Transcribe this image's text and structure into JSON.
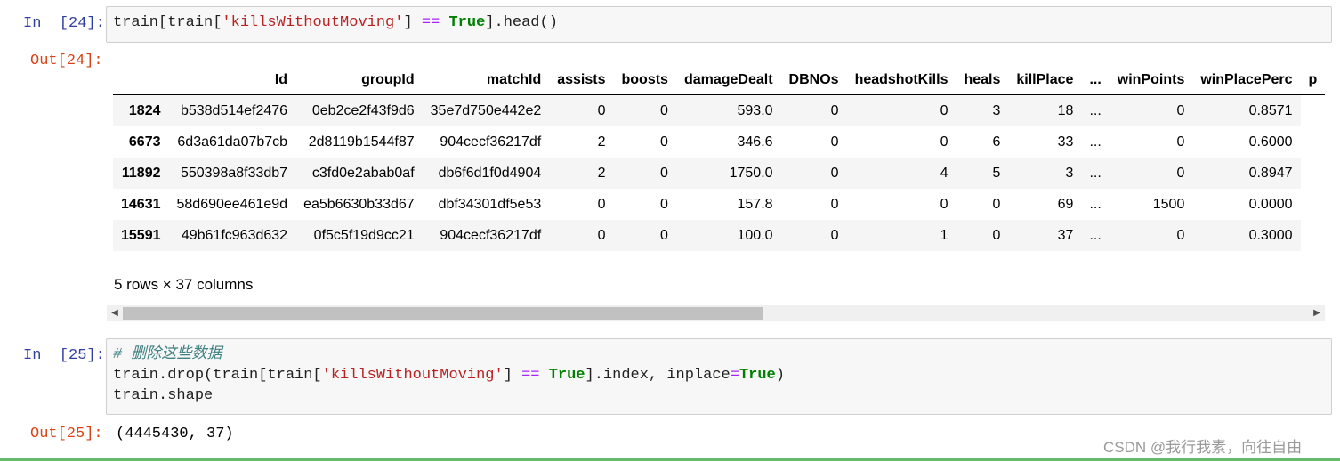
{
  "cells": [
    {
      "in_prompt": "In  [24]:",
      "code_parts": [
        "train[train[",
        "'killsWithoutMoving'",
        "] ",
        "==",
        " ",
        "True",
        "].head()"
      ],
      "out_prompt": "Out[24]:"
    },
    {
      "in_prompt": "In  [25]:",
      "comment": "# 删除这些数据",
      "line2_parts": [
        "train.drop(train[train[",
        "'killsWithoutMoving'",
        "] ",
        "==",
        " ",
        "True",
        "].index, inplace",
        "=",
        "True",
        ")"
      ],
      "line3": "train.shape",
      "out_prompt": "Out[25]:",
      "output": "(4445430, 37)"
    }
  ],
  "dataframe": {
    "columns": [
      "Id",
      "groupId",
      "matchId",
      "assists",
      "boosts",
      "damageDealt",
      "DBNOs",
      "headshotKills",
      "heals",
      "killPlace",
      "...",
      "winPoints",
      "winPlacePerc",
      "p"
    ],
    "rows": [
      {
        "index": "1824",
        "cells": [
          "b538d514ef2476",
          "0eb2ce2f43f9d6",
          "35e7d750e442e2",
          "0",
          "0",
          "593.0",
          "0",
          "0",
          "3",
          "18",
          "...",
          "0",
          "0.8571"
        ]
      },
      {
        "index": "6673",
        "cells": [
          "6d3a61da07b7cb",
          "2d8119b1544f87",
          "904cecf36217df",
          "2",
          "0",
          "346.6",
          "0",
          "0",
          "6",
          "33",
          "...",
          "0",
          "0.6000"
        ]
      },
      {
        "index": "11892",
        "cells": [
          "550398a8f33db7",
          "c3fd0e2abab0af",
          "db6f6d1f0d4904",
          "2",
          "0",
          "1750.0",
          "0",
          "4",
          "5",
          "3",
          "...",
          "0",
          "0.8947"
        ]
      },
      {
        "index": "14631",
        "cells": [
          "58d690ee461e9d",
          "ea5b6630b33d67",
          "dbf34301df5e53",
          "0",
          "0",
          "157.8",
          "0",
          "0",
          "0",
          "69",
          "...",
          "1500",
          "0.0000"
        ]
      },
      {
        "index": "15591",
        "cells": [
          "49b61fc963d632",
          "0f5c5f19d9cc21",
          "904cecf36217df",
          "0",
          "0",
          "100.0",
          "0",
          "1",
          "0",
          "37",
          "...",
          "0",
          "0.3000"
        ]
      }
    ],
    "summary": "5 rows × 37 columns"
  },
  "scrollbar": {
    "left_arrow": "◀",
    "right_arrow": "▶",
    "thumb_fraction": 0.54
  },
  "watermark": "CSDN @我行我素，向往自由",
  "colors": {
    "in_prompt": "#303f9f",
    "out_prompt": "#d84315",
    "string": "#ba2121",
    "keyword": "#008000",
    "operator": "#aa22ff",
    "comment": "#408080"
  }
}
